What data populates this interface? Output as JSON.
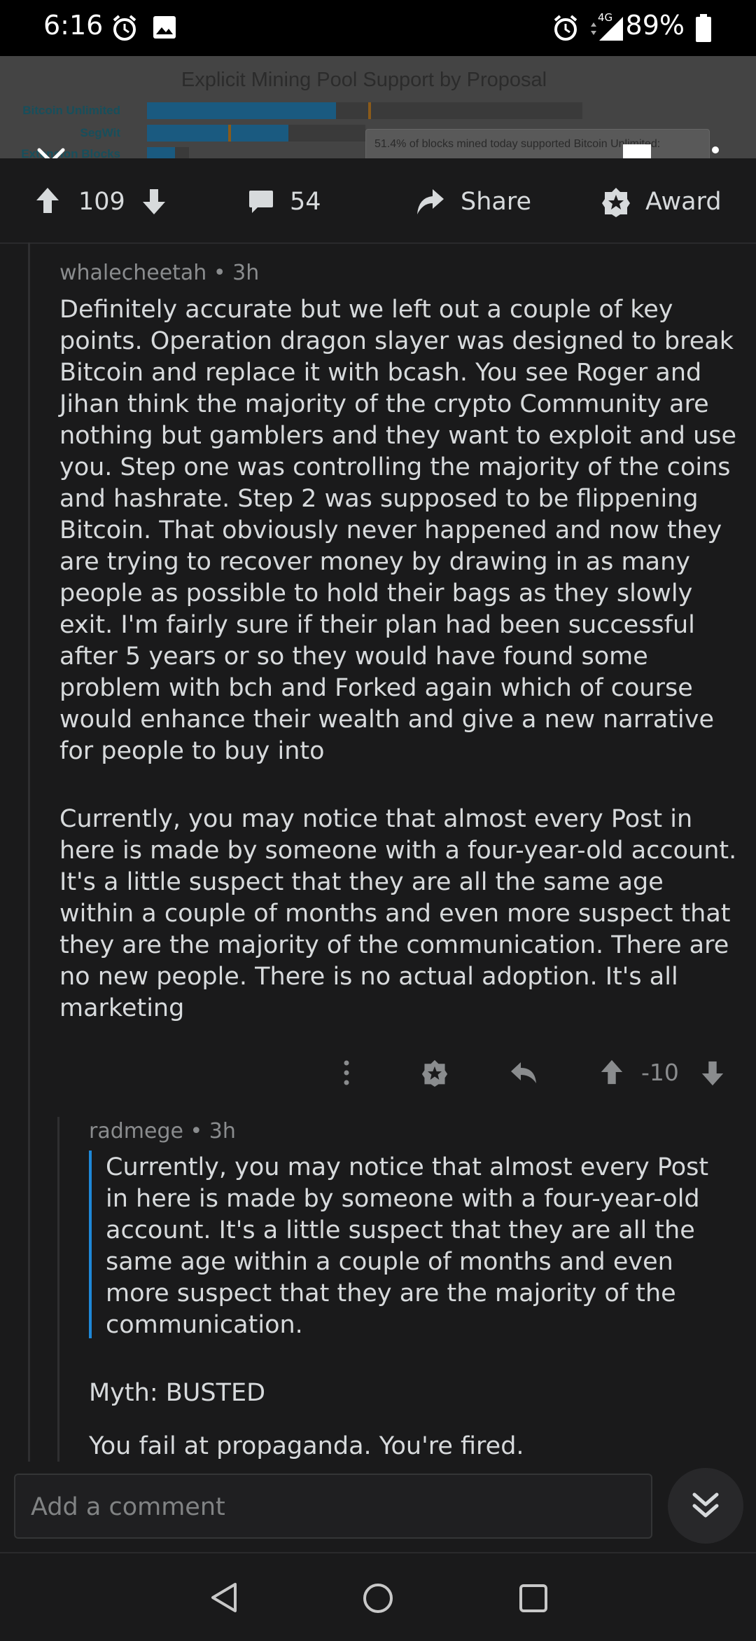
{
  "status_bar": {
    "time": "6:16",
    "network": "4G",
    "battery": "89%"
  },
  "post_header": {
    "chart_title": "Explicit Mining Pool Support by Proposal",
    "categories": [
      "Bitcoin Unlimited",
      "SegWit",
      "Extension Blocks"
    ],
    "tooltip": "51.4% of blocks mined today supported Bitcoin Unlimited:",
    "close_icon": "close-icon",
    "bookmark_icon": "bookmark-icon",
    "more_icon": "more-vertical-icon"
  },
  "action_bar": {
    "upvotes": "109",
    "comments": "54",
    "share": "Share",
    "award": "Award"
  },
  "comment1": {
    "author": "whalecheetah",
    "sep": "•",
    "age": "3h",
    "paragraph1": "Definitely accurate but we left out a couple of key points. Operation dragon slayer was designed to break Bitcoin and replace it with bcash. You see Roger and Jihan think the majority of the crypto Community are nothing but gamblers and they want to exploit and use you. Step one was controlling the majority of the coins and hashrate. Step 2 was supposed to be flippening Bitcoin. That obviously never happened and now they are trying to recover money by drawing in as many people as possible to hold their bags as they slowly exit. I'm fairly sure if their plan had been successful after 5 years or so they would have found some problem with bch and Forked again which of course would enhance their wealth and give a new narrative for people to buy into",
    "paragraph2": "Currently, you may notice that almost every Post in here is made by someone with a four-year-old account. It's a little suspect that they are all the same age within a couple of months and even more suspect that they are the majority of the communication. There are no new people. There is no actual adoption. It's all marketing",
    "score": "-10"
  },
  "comment2": {
    "author": "radmege",
    "sep": "•",
    "age": "3h",
    "quote": "Currently, you may notice that almost every Post in here is made by someone with a four-year-old account. It's a little suspect that they are all the same age within a couple of months and even more suspect that they are the majority of the communication.",
    "line1": "Myth: BUSTED",
    "line2": "You fail at propaganda. You're fired."
  },
  "composer": {
    "placeholder": "Add a comment"
  }
}
